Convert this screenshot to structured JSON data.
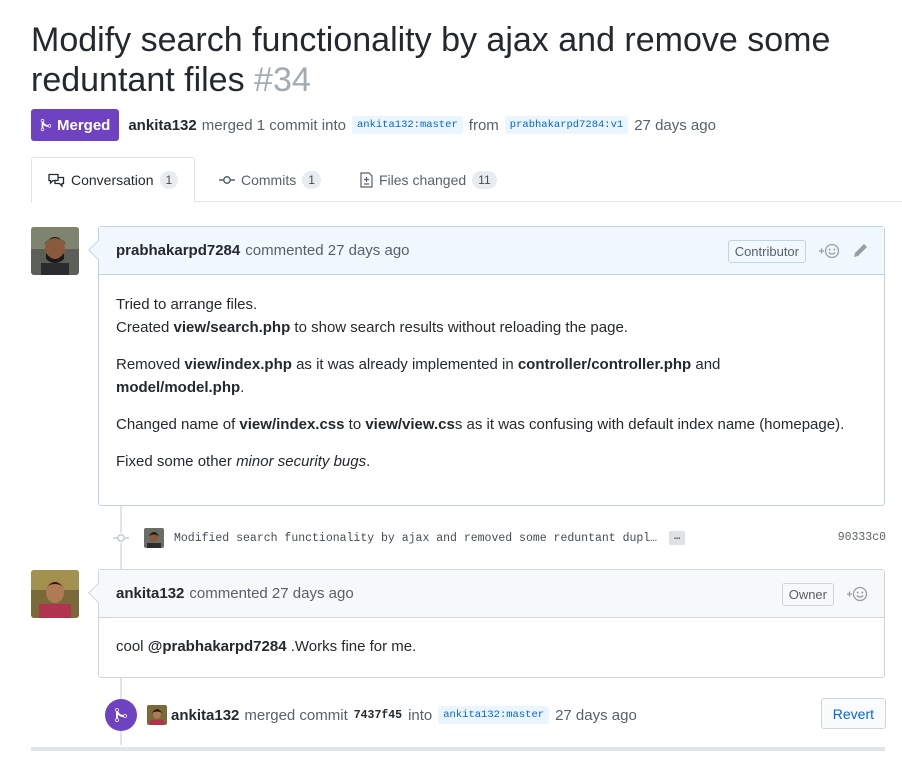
{
  "pr": {
    "title": "Modify search functionality by ajax and remove some reduntant files",
    "number": "#34",
    "state_label": "Merged",
    "author": "ankita132",
    "merged_text": "merged 1 commit into",
    "base_branch": "ankita132:master",
    "from_text": "from",
    "head_branch": "prabhakarpd7284:v1",
    "time_ago": "27 days ago"
  },
  "tabs": [
    {
      "label": "Conversation",
      "count": "1",
      "icon": "comment-discussion-icon"
    },
    {
      "label": "Commits",
      "count": "1",
      "icon": "git-commit-icon"
    },
    {
      "label": "Files changed",
      "count": "11",
      "icon": "file-diff-icon"
    }
  ],
  "comment1": {
    "author": "prabhakarpd7284",
    "meta": "commented 27 days ago",
    "role": "Contributor",
    "reaction_icon": "smiley-icon",
    "edit_icon": "pencil-icon",
    "p1_line1": "Tried to arrange files.",
    "p1_pre": "Created ",
    "p1_bold": "view/search.php",
    "p1_post": " to show search results without reloading the page.",
    "p2_pre": "Removed ",
    "p2_bold1": "view/index.php",
    "p2_mid": " as it was already implemented in ",
    "p2_bold2": "controller/controller.php",
    "p2_and": " and ",
    "p2_bold3": "model/model.php",
    "p2_post": ".",
    "p3_pre": "Changed name of ",
    "p3_bold1": "view/index.css",
    "p3_mid": " to ",
    "p3_bold2": "view/view.cs",
    "p3_post": "s as it was confusing with default index name (homepage).",
    "p4_pre": "Fixed some other ",
    "p4_italic": "minor security bugs",
    "p4_post": "."
  },
  "commit": {
    "message": "Modified search functionality by ajax and removed some reduntant dupl…",
    "ellipsis": "…",
    "sha": "90333c0"
  },
  "comment2": {
    "author": "ankita132",
    "meta": "commented 27 days ago",
    "role": "Owner",
    "mention": "@prabhakarpd7284",
    "pre": "cool ",
    "post": " .Works fine for me."
  },
  "merge_event": {
    "author": "ankita132",
    "text1": "merged commit",
    "sha": "7437f45",
    "text2": "into",
    "branch": "ankita132:master",
    "time_ago": "27 days ago",
    "revert_label": "Revert"
  },
  "colors": {
    "merged_purple": "#6f42c1",
    "link_blue": "#0366d6",
    "contributor_header": "#f1f8ff",
    "owner_header": "#f6f8fa"
  }
}
